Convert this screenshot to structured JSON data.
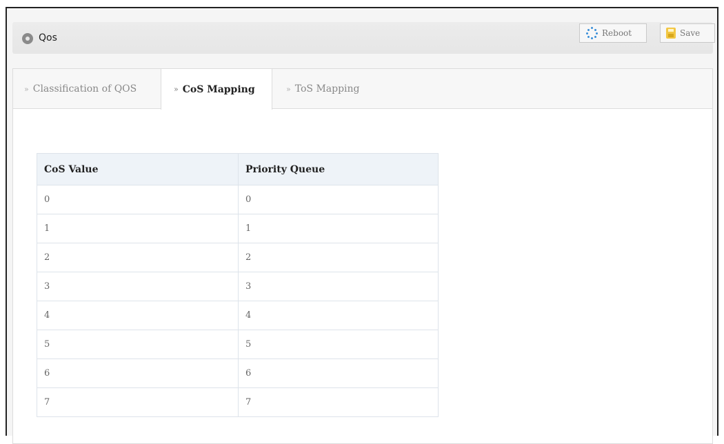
{
  "header": {
    "title": "Qos",
    "reboot_label": "Reboot",
    "save_label": "Save"
  },
  "tabs": [
    {
      "label": "Classification of QOS",
      "active": false
    },
    {
      "label": "CoS Mapping",
      "active": true
    },
    {
      "label": "ToS Mapping",
      "active": false
    }
  ],
  "table": {
    "columns": [
      "CoS Value",
      "Priority Queue"
    ],
    "rows": [
      [
        "0",
        "0"
      ],
      [
        "1",
        "1"
      ],
      [
        "2",
        "2"
      ],
      [
        "3",
        "3"
      ],
      [
        "4",
        "4"
      ],
      [
        "5",
        "5"
      ],
      [
        "6",
        "6"
      ],
      [
        "7",
        "7"
      ]
    ]
  },
  "colors": {
    "accent": "#3a8fd8",
    "save_icon": "#f2c744",
    "table_header_bg": "#eef3f8"
  },
  "icons": {
    "title": "location-pin-icon",
    "reboot": "reboot-icon",
    "save": "save-icon",
    "tab_arrow": "double-chevron-right-icon"
  }
}
